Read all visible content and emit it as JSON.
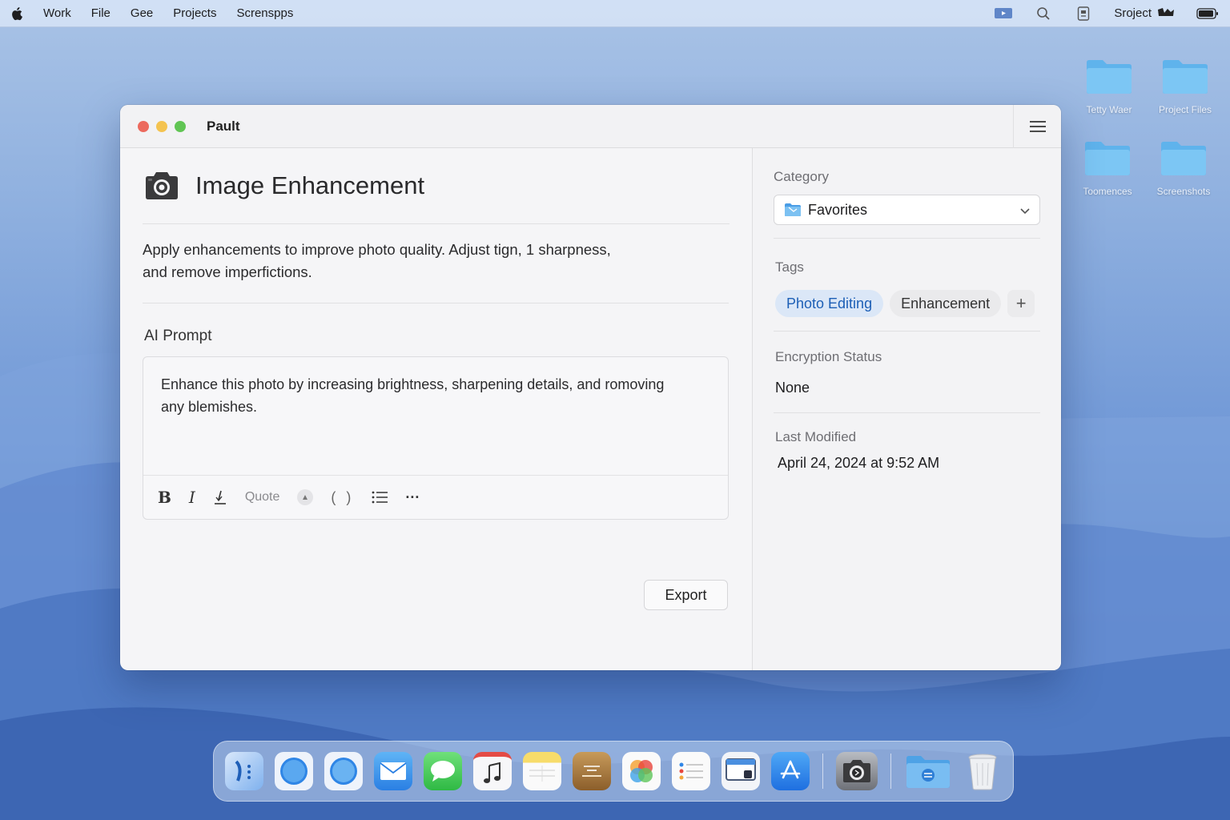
{
  "menubar": {
    "items": [
      "Work",
      "File",
      "Gee",
      "Projects",
      "Screnspps"
    ],
    "right_label": "Sroject"
  },
  "desktop": {
    "icons": [
      {
        "label": "Tetty Waer"
      },
      {
        "label": "Project Files"
      },
      {
        "label": "Toomences"
      },
      {
        "label": "Screenshots"
      }
    ]
  },
  "window": {
    "title": "Pault",
    "note": {
      "title": "Image Enhancement",
      "description_line1": "Apply enhancements to improve photo quality. Adjust tign, 1 sharpness,",
      "description_line2": "and remove imperfictions.",
      "prompt_label": "AI Prompt",
      "prompt_line1": "Enhance this photo by increasing brightness, sharpening details, and romoving",
      "prompt_line2": "any blemishes.",
      "toolbar": {
        "bold": "B",
        "italic": "I",
        "quote": "Quote",
        "code": "( )",
        "more": "···"
      },
      "export_label": "Export"
    },
    "sidebar": {
      "category_label": "Category",
      "category_value": "Favorites",
      "tags_label": "Tags",
      "tags": [
        "Photo Editing",
        "Enhancement"
      ],
      "add_tag": "+",
      "encryption_label": "Encryption Status",
      "encryption_value": "None",
      "modified_label": "Last Modified",
      "modified_value": "April 24, 2024 at 9:52 AM"
    }
  },
  "dock": {
    "apps": [
      "finder-icon",
      "safari-icon",
      "safari-icon",
      "mail-icon",
      "messages-icon",
      "music-icon",
      "notes-icon",
      "books-icon",
      "photos-icon",
      "reminders-icon",
      "preview-icon",
      "app-store-icon",
      "screenshot-icon",
      "folder-icon",
      "trash-icon"
    ]
  },
  "colors": {
    "accent": "#1d5fb6",
    "tag_bg": "#dbe7f7",
    "close": "#ec6a5e",
    "minimize": "#f4c350",
    "zoom": "#61c554"
  }
}
